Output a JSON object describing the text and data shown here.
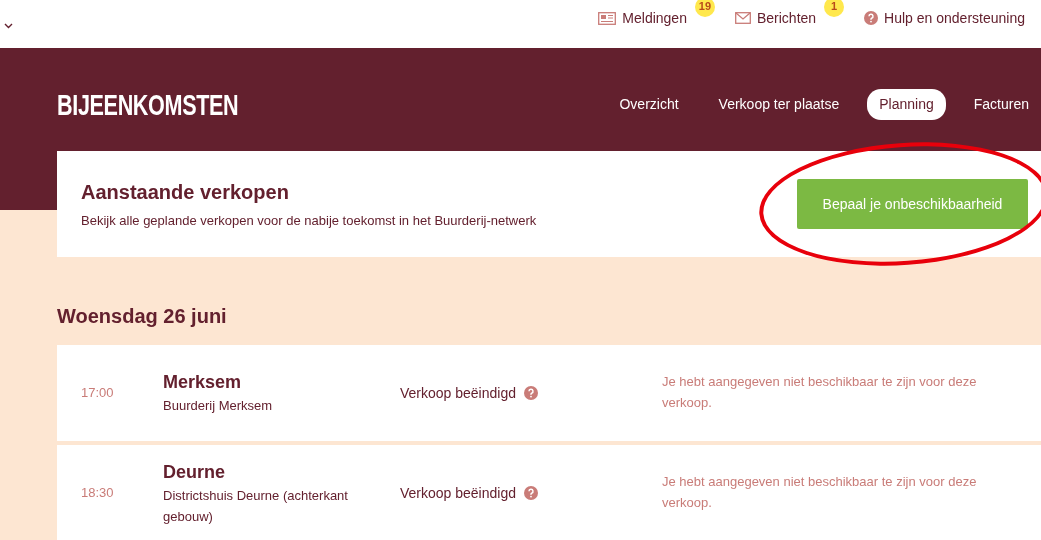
{
  "top_bar": {
    "links": [
      {
        "kind": "news",
        "label": "Meldingen",
        "badge": "19"
      },
      {
        "kind": "mail",
        "label": "Berichten",
        "badge": "1"
      },
      {
        "kind": "help",
        "label": "Hulp en ondersteuning"
      }
    ]
  },
  "header": {
    "logo": "BIJEENKOMSTEN",
    "nav": [
      {
        "label": "Overzicht",
        "selected": false
      },
      {
        "label": "Verkoop ter plaatse",
        "selected": false
      },
      {
        "label": "Planning",
        "selected": true
      },
      {
        "label": "Facturen",
        "selected": false
      }
    ]
  },
  "intro": {
    "title": "Aanstaande verkopen",
    "subtitle": "Bekijk alle geplande verkopen voor de nabije toekomst in het Buurderij-netwerk",
    "button": "Bepaal je onbeschikbaarheid",
    "highlighted": true
  },
  "days": [
    {
      "title": "Woensdag 26 juni",
      "sales": [
        {
          "time": "17:00",
          "name": "Merksem",
          "place": "Buurderij Merksem",
          "status": "Verkoop beëindigd",
          "note": "Je hebt aangegeven niet beschikbaar te zijn voor deze verkoop."
        },
        {
          "time": "18:30",
          "name": "Deurne",
          "place": "Districtshuis Deurne (achterkant gebouw)",
          "status": "Verkoop beëindigd",
          "note": "Je hebt aangegeven niet beschikbaar te zijn voor deze verkoop."
        }
      ]
    }
  ]
}
